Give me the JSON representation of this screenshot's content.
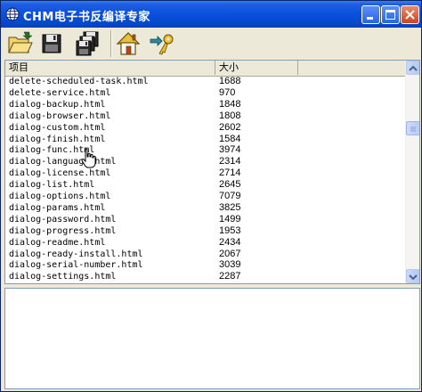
{
  "window": {
    "title": "CHM电子书反编译专家",
    "controls": [
      "minimize",
      "maximize",
      "close"
    ]
  },
  "toolbar": {
    "buttons": [
      {
        "name": "open",
        "icon": "folder-open-icon"
      },
      {
        "name": "save",
        "icon": "floppy-disk-icon"
      },
      {
        "name": "save-all",
        "icon": "multiple-disks-icon"
      },
      {
        "name": "home",
        "icon": "home-icon"
      },
      {
        "name": "exit",
        "icon": "key-icon"
      }
    ]
  },
  "list": {
    "columns": [
      "项目",
      "大小"
    ],
    "rows": [
      {
        "name": "delete-scheduled-task.html",
        "size": "1688"
      },
      {
        "name": "delete-service.html",
        "size": "970"
      },
      {
        "name": "dialog-backup.html",
        "size": "1848"
      },
      {
        "name": "dialog-browser.html",
        "size": "1808"
      },
      {
        "name": "dialog-custom.html",
        "size": "2602"
      },
      {
        "name": "dialog-finish.html",
        "size": "1584"
      },
      {
        "name": "dialog-func.html",
        "size": "3974"
      },
      {
        "name": "dialog-language.html",
        "size": "2314"
      },
      {
        "name": "dialog-license.html",
        "size": "2714"
      },
      {
        "name": "dialog-list.html",
        "size": "2645"
      },
      {
        "name": "dialog-options.html",
        "size": "7079"
      },
      {
        "name": "dialog-params.html",
        "size": "3825"
      },
      {
        "name": "dialog-password.html",
        "size": "1499"
      },
      {
        "name": "dialog-progress.html",
        "size": "1953"
      },
      {
        "name": "dialog-readme.html",
        "size": "2434"
      },
      {
        "name": "dialog-ready-install.html",
        "size": "2067"
      },
      {
        "name": "dialog-serial-number.html",
        "size": "3039"
      },
      {
        "name": "dialog-settings.html",
        "size": "2287"
      }
    ]
  },
  "colors": {
    "titlebar": "#0a50dd",
    "window_face": "#ece9d8",
    "list_border": "#7f9db9"
  }
}
